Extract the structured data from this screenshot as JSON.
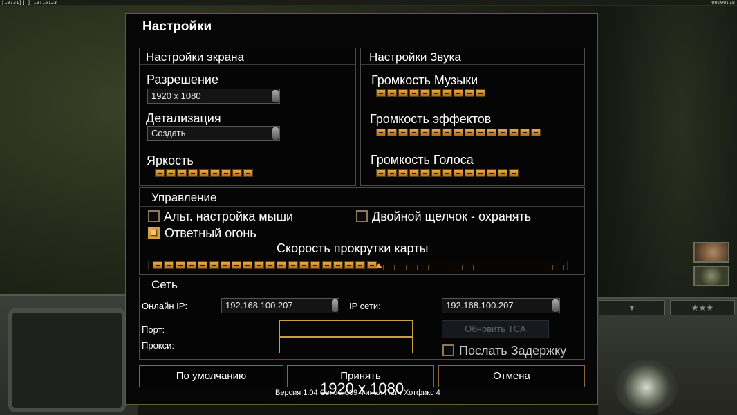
{
  "status_bar": {
    "left_clock": "[10:31][ ] 19:15:23",
    "right_clock": "00:00:18"
  },
  "dialog": {
    "title": "Настройки"
  },
  "screen_settings": {
    "title": "Настройки экрана",
    "resolution_label": "Разрешение",
    "resolution_value": "1920 x 1080",
    "detail_label": "Детализация",
    "detail_value": "Создать",
    "brightness_label": "Яркость",
    "brightness_level": 9
  },
  "sound_settings": {
    "title": "Настройки Звука",
    "music_label": "Громкость Музыки",
    "music_level": 10,
    "effects_label": "Громкость эффектов",
    "effects_level": 15,
    "voice_label": "Громкость Голоса",
    "voice_level": 13
  },
  "controls": {
    "title": "Управление",
    "alt_mouse_label": "Альт. настройка мыши",
    "alt_mouse_checked": false,
    "double_click_label": "Двойной щелчок - охранять",
    "double_click_checked": false,
    "return_fire_label": "Ответный огонь",
    "return_fire_checked": true,
    "scroll_speed_label": "Скорость прокрутки карты",
    "scroll_speed_level": 20,
    "scroll_speed_max": 37
  },
  "network": {
    "title": "Сеть",
    "online_ip_label": "Онлайн IP:",
    "online_ip_value": "192.168.100.207",
    "network_ip_label": "IP сети:",
    "network_ip_value": "192.168.100.207",
    "port_label": "Порт:",
    "port_value": "",
    "proxy_label": "Прокси:",
    "proxy_value": "",
    "update_tca_label": "Обновить TCA",
    "send_delay_label": "Послать Задержку",
    "send_delay_checked": false
  },
  "buttons": {
    "defaults": "По умолчанию",
    "accept": "Принять",
    "cancel": "Отмена"
  },
  "footer": {
    "version": "Версия 1.04 Contra 009 Финал Патч Хотфикс 4",
    "overlay": "1920 x 1080"
  },
  "colors": {
    "accent": "#c8a040",
    "slider": "#e0a040"
  }
}
